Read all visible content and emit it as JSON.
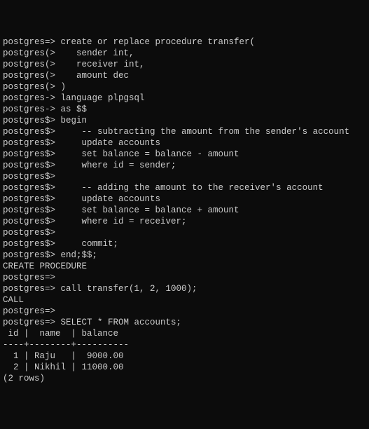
{
  "lines": [
    "postgres=> create or replace procedure transfer(",
    "postgres(>    sender int,",
    "postgres(>    receiver int,",
    "postgres(>    amount dec",
    "postgres(> )",
    "postgres-> language plpgsql",
    "postgres-> as $$",
    "postgres$> begin",
    "postgres$>     -- subtracting the amount from the sender's account",
    "postgres$>     update accounts",
    "postgres$>     set balance = balance - amount",
    "postgres$>     where id = sender;",
    "postgres$>",
    "postgres$>     -- adding the amount to the receiver's account",
    "postgres$>     update accounts",
    "postgres$>     set balance = balance + amount",
    "postgres$>     where id = receiver;",
    "postgres$>",
    "postgres$>     commit;",
    "postgres$> end;$$;",
    "CREATE PROCEDURE",
    "postgres=>",
    "postgres=> call transfer(1, 2, 1000);",
    "CALL",
    "postgres=>",
    "postgres=> SELECT * FROM accounts;",
    " id |  name  | balance",
    "----+--------+----------",
    "  1 | Raju   |  9000.00",
    "  2 | Nikhil | 11000.00",
    "(2 rows)"
  ]
}
